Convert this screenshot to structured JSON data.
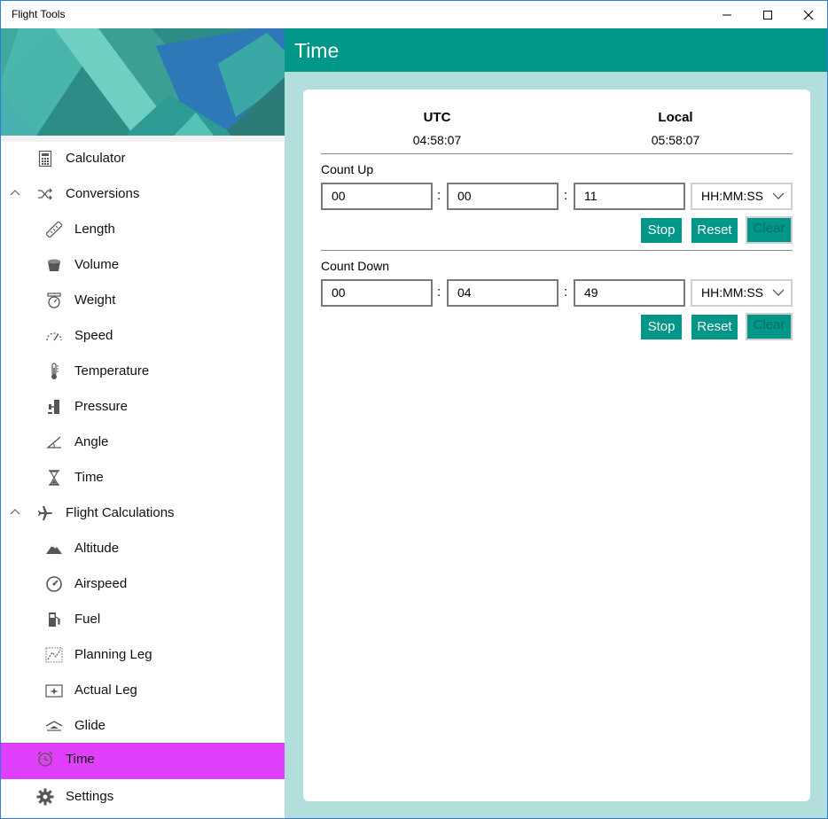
{
  "window": {
    "title": "Flight Tools"
  },
  "colors": {
    "accent": "#009688",
    "selected": "#e040fb",
    "background": "#b2dfdb"
  },
  "sidebar": {
    "items": [
      {
        "label": "Calculator",
        "icon": "calculator-icon"
      },
      {
        "label": "Conversions",
        "icon": "shuffle-icon"
      },
      {
        "label": "Length",
        "icon": "ruler-icon"
      },
      {
        "label": "Volume",
        "icon": "bucket-icon"
      },
      {
        "label": "Weight",
        "icon": "scale-icon"
      },
      {
        "label": "Speed",
        "icon": "speedometer-icon"
      },
      {
        "label": "Temperature",
        "icon": "thermometer-icon"
      },
      {
        "label": "Pressure",
        "icon": "pressure-icon"
      },
      {
        "label": "Angle",
        "icon": "angle-icon"
      },
      {
        "label": "Time",
        "icon": "hourglass-icon"
      },
      {
        "label": "Flight Calculations",
        "icon": "airplane-icon"
      },
      {
        "label": "Altitude",
        "icon": "mountain-icon"
      },
      {
        "label": "Airspeed",
        "icon": "gauge-icon"
      },
      {
        "label": "Fuel",
        "icon": "fuel-pump-icon"
      },
      {
        "label": "Planning Leg",
        "icon": "map-route-icon"
      },
      {
        "label": "Actual Leg",
        "icon": "map-plane-icon"
      },
      {
        "label": "Glide",
        "icon": "glide-icon"
      },
      {
        "label": "Time",
        "icon": "alarm-clock-icon"
      },
      {
        "label": "Settings",
        "icon": "gear-icon"
      }
    ]
  },
  "main": {
    "title": "Time",
    "utc": {
      "label": "UTC",
      "value": "04:58:07"
    },
    "local": {
      "label": "Local",
      "value": "05:58:07"
    },
    "count_up": {
      "title": "Count Up",
      "hours": "00",
      "minutes": "00",
      "seconds": "11",
      "format": "HH:MM:SS",
      "stop": "Stop",
      "reset": "Reset",
      "clear": "Clear"
    },
    "count_down": {
      "title": "Count Down",
      "hours": "00",
      "minutes": "04",
      "seconds": "49",
      "format": "HH:MM:SS",
      "stop": "Stop",
      "reset": "Reset",
      "clear": "Clear"
    },
    "separator": ":"
  }
}
